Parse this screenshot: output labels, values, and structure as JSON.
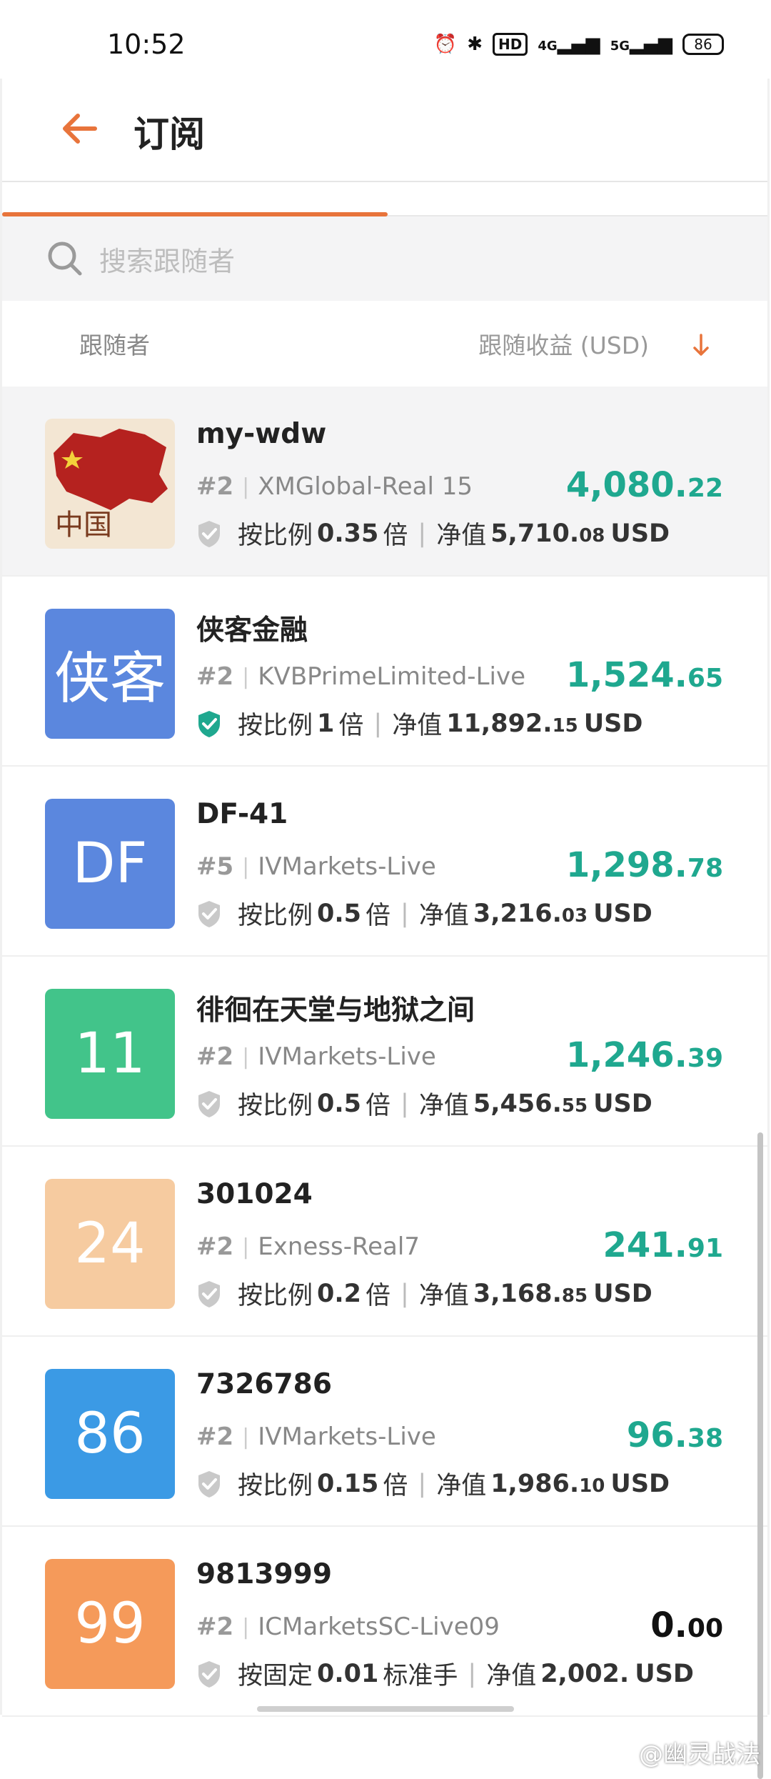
{
  "status_bar": {
    "time": "10:52",
    "hd_badge": "HD",
    "signal_4g": "4G",
    "signal_5g": "5G",
    "battery": "86"
  },
  "header": {
    "title": "订阅"
  },
  "search": {
    "placeholder": "搜索跟随者"
  },
  "columns": {
    "follower": "跟随者",
    "profit": "跟随收益 (USD)"
  },
  "followers": [
    {
      "name": "my-wdw",
      "rank": "#2",
      "server": "XMGlobal-Real 15",
      "mode_label": "按比例",
      "mode_value": "0.35",
      "mode_unit": "倍",
      "equity_label": "净值",
      "equity_int": "5,710.",
      "equity_dec": "08",
      "currency": "USD",
      "profit_int": "4,080.",
      "profit_dec": "22",
      "avatar_text": "中国",
      "avatar_color": "#b5221f",
      "verified": false
    },
    {
      "name": "侠客金融",
      "rank": "#2",
      "server": "KVBPrimeLimited-Live",
      "mode_label": "按比例",
      "mode_value": "1",
      "mode_unit": "倍",
      "equity_label": "净值",
      "equity_int": "11,892.",
      "equity_dec": "15",
      "currency": "USD",
      "profit_int": "1,524.",
      "profit_dec": "65",
      "avatar_text": "侠客",
      "avatar_color": "#5b87de",
      "verified": true
    },
    {
      "name": "DF-41",
      "rank": "#5",
      "server": "IVMarkets-Live",
      "mode_label": "按比例",
      "mode_value": "0.5",
      "mode_unit": "倍",
      "equity_label": "净值",
      "equity_int": "3,216.",
      "equity_dec": "03",
      "currency": "USD",
      "profit_int": "1,298.",
      "profit_dec": "78",
      "avatar_text": "DF",
      "avatar_color": "#5b87de",
      "verified": false
    },
    {
      "name": "徘徊在天堂与地狱之间",
      "rank": "#2",
      "server": "IVMarkets-Live",
      "mode_label": "按比例",
      "mode_value": "0.5",
      "mode_unit": "倍",
      "equity_label": "净值",
      "equity_int": "5,456.",
      "equity_dec": "55",
      "currency": "USD",
      "profit_int": "1,246.",
      "profit_dec": "39",
      "avatar_text": "11",
      "avatar_color": "#42c48a",
      "verified": false
    },
    {
      "name": "301024",
      "rank": "#2",
      "server": "Exness-Real7",
      "mode_label": "按比例",
      "mode_value": "0.2",
      "mode_unit": "倍",
      "equity_label": "净值",
      "equity_int": "3,168.",
      "equity_dec": "85",
      "currency": "USD",
      "profit_int": "241.",
      "profit_dec": "91",
      "avatar_text": "24",
      "avatar_color": "#f6cba0",
      "verified": false
    },
    {
      "name": "7326786",
      "rank": "#2",
      "server": "IVMarkets-Live",
      "mode_label": "按比例",
      "mode_value": "0.15",
      "mode_unit": "倍",
      "equity_label": "净值",
      "equity_int": "1,986.",
      "equity_dec": "10",
      "currency": "USD",
      "profit_int": "96.",
      "profit_dec": "38",
      "avatar_text": "86",
      "avatar_color": "#3b9ae5",
      "verified": false
    },
    {
      "name": "9813999",
      "rank": "#2",
      "server": "ICMarketsSC-Live09",
      "mode_label": "按固定",
      "mode_value": "0.01",
      "mode_unit": "标准手",
      "equity_label": "净值",
      "equity_int": "2,002.",
      "equity_dec": "",
      "currency": "USD",
      "profit_int": "0.",
      "profit_dec": "00",
      "avatar_text": "99",
      "avatar_color": "#f59a5a",
      "verified": false
    }
  ],
  "watermark": "@幽灵战法",
  "colors": {
    "accent": "#e8743b",
    "profit_green": "#1fa88f",
    "verified_green": "#1fa88f"
  }
}
